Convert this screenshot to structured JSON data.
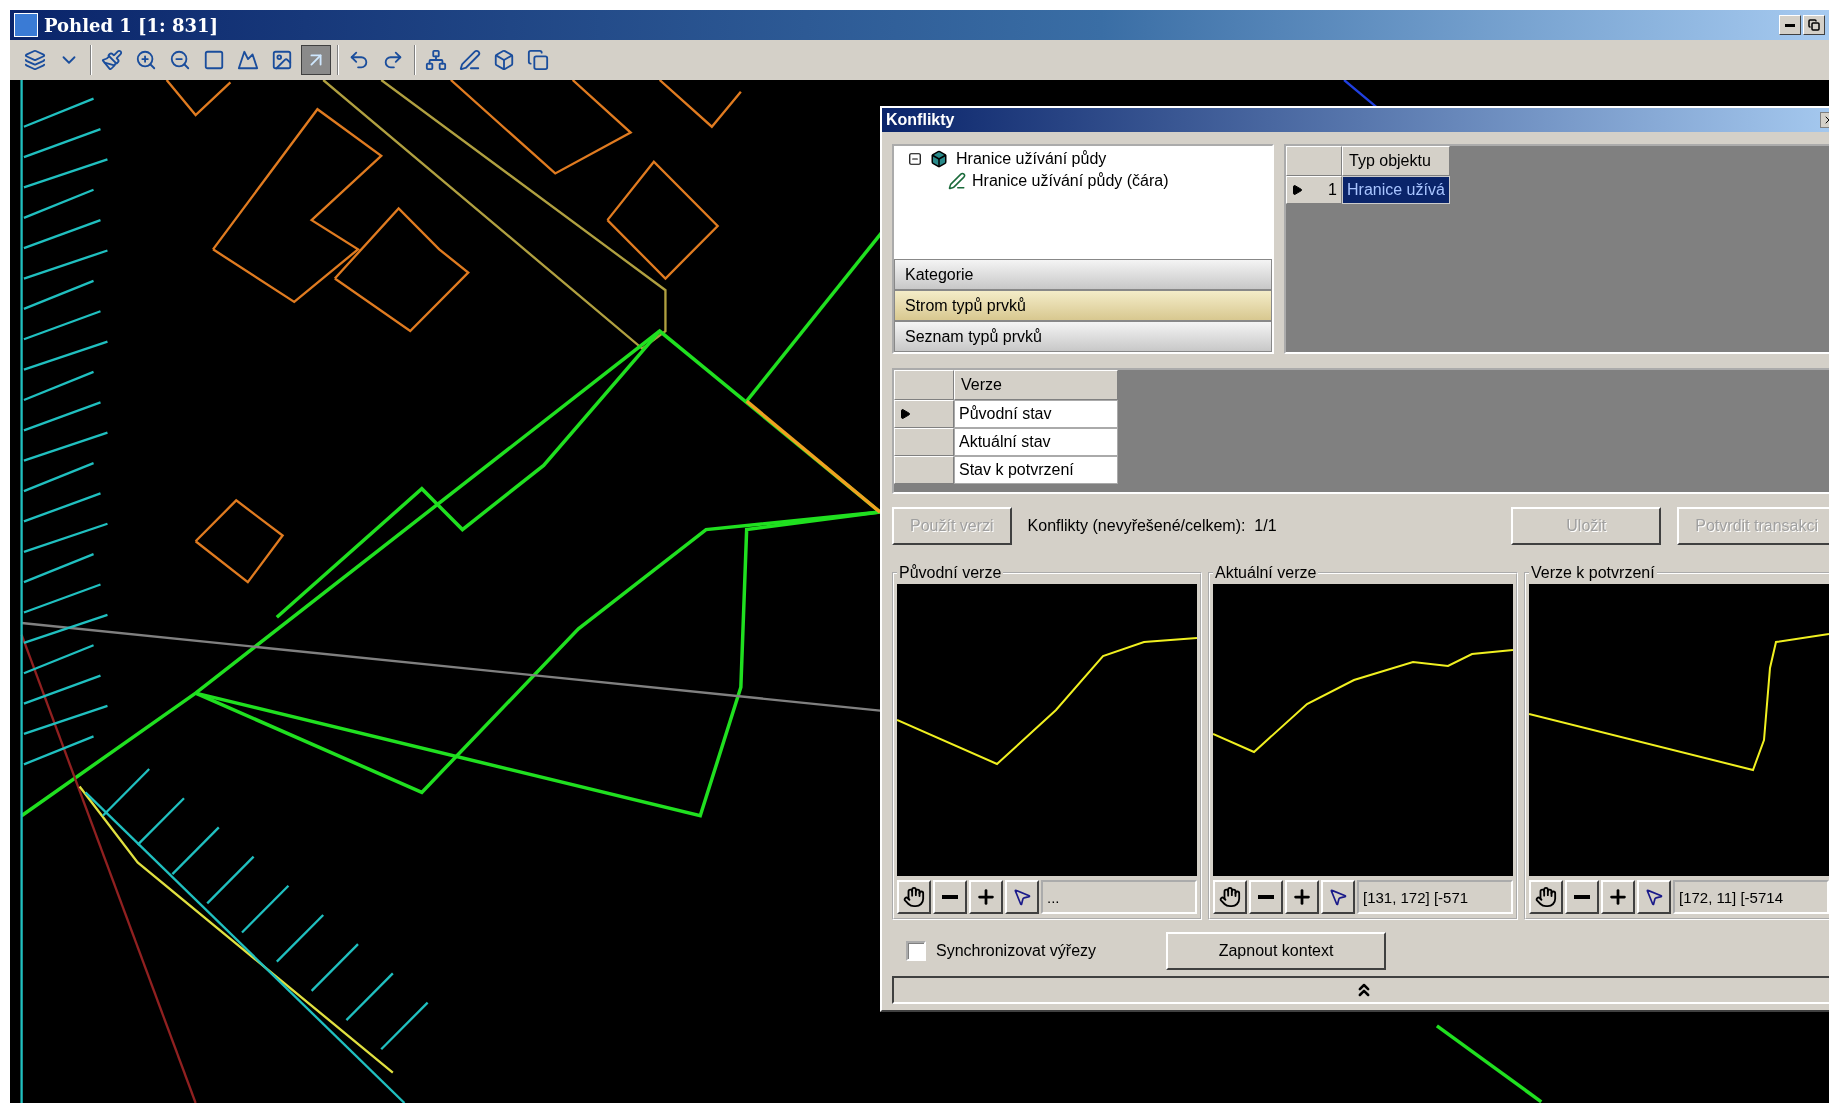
{
  "window": {
    "title": "Pohled 1 [1: 831]"
  },
  "toolbar": {
    "groups": [
      [
        {
          "kind": "layers",
          "selected": false
        },
        {
          "kind": "dropdown",
          "selected": false
        }
      ],
      [
        {
          "kind": "brush",
          "selected": false
        },
        {
          "kind": "zoom-in",
          "selected": false
        },
        {
          "kind": "zoom-out",
          "selected": false
        },
        {
          "kind": "frame",
          "selected": false
        },
        {
          "kind": "mountain",
          "selected": false
        },
        {
          "kind": "picture",
          "selected": false
        },
        {
          "kind": "arrow",
          "selected": true
        }
      ],
      [
        {
          "kind": "undo",
          "selected": false
        },
        {
          "kind": "redo",
          "selected": false
        }
      ],
      [
        {
          "kind": "network",
          "selected": false
        },
        {
          "kind": "pen",
          "selected": false
        },
        {
          "kind": "box",
          "selected": false
        },
        {
          "kind": "copy",
          "selected": false
        }
      ]
    ]
  },
  "dialog": {
    "title": "Konflikty",
    "tree": [
      {
        "label": "Hranice užívání půdy",
        "expanded": true,
        "children": [
          {
            "label": "Hranice užívání půdy (čára)"
          }
        ]
      }
    ],
    "categories": [
      {
        "label": "Kategorie",
        "selected": false
      },
      {
        "label": "Strom typů prvků",
        "selected": true
      },
      {
        "label": "Seznam typů prvků",
        "selected": false
      }
    ],
    "object_table": {
      "columns": [
        "Typ objektu"
      ],
      "rows": [
        {
          "number": "1",
          "value": "Hranice užívá",
          "selected": true
        }
      ]
    },
    "version_table": {
      "columns": [
        "Verze"
      ],
      "rows": [
        {
          "label": "Původní stav",
          "selected": true
        },
        {
          "label": "Aktuální stav",
          "selected": false
        },
        {
          "label": "Stav k potvrzení",
          "selected": false
        }
      ]
    },
    "use_version_button": {
      "label": "Použít verzi",
      "disabled": true
    },
    "conflict_status": "Konflikty (nevyřešené/celkem):  1/1",
    "save_button": {
      "label": "Uložit",
      "disabled": true
    },
    "confirm_button": {
      "label": "Potvrdit transakci",
      "disabled": true
    },
    "previews": [
      {
        "title": "Původní verze",
        "coords": "..."
      },
      {
        "title": "Aktuální verze",
        "coords": "[131, 172] [-571"
      },
      {
        "title": "Verze k potvrzení",
        "coords": "[172, 11] [-5714"
      }
    ],
    "sync_checkbox": {
      "label": "Synchronizovat výřezy",
      "checked": false
    },
    "context_button": {
      "label": "Zapnout kontext"
    }
  }
}
